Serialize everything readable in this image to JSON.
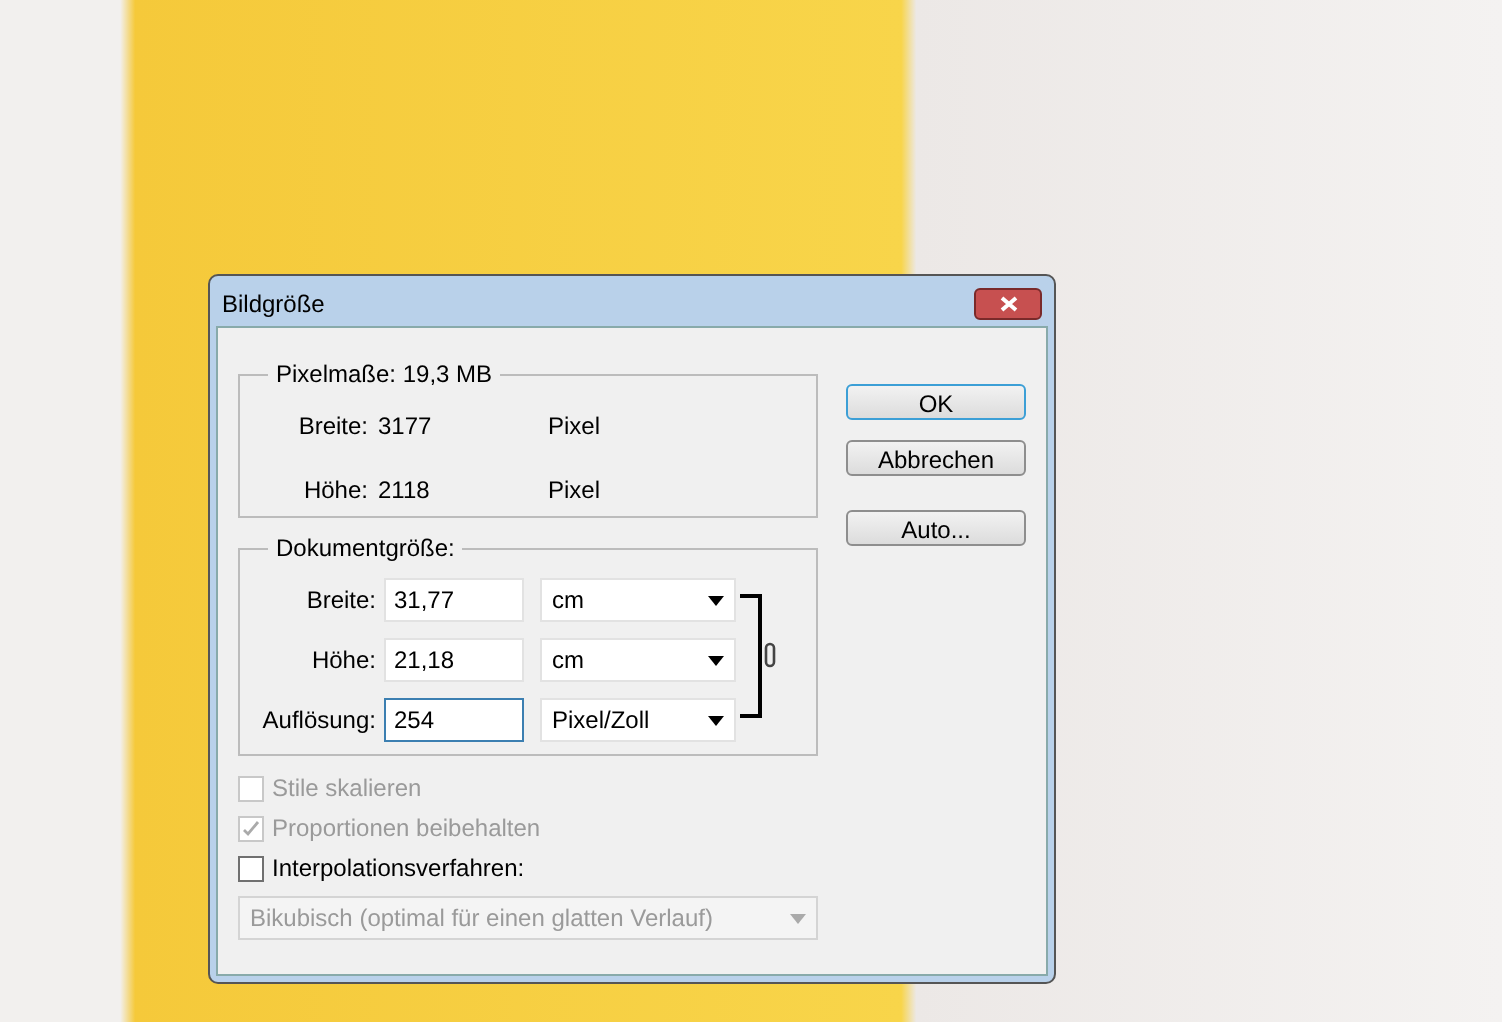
{
  "window": {
    "title": "Bildgröße"
  },
  "pixel_dimensions": {
    "legend": "Pixelmaße: 19,3 MB",
    "rows": [
      {
        "label": "Breite:",
        "value": "3177",
        "unit": "Pixel"
      },
      {
        "label": "Höhe:",
        "value": "2118",
        "unit": "Pixel"
      }
    ]
  },
  "document_size": {
    "legend": "Dokumentgröße:",
    "rows": [
      {
        "label": "Breite:",
        "value": "31,77",
        "unit": "cm",
        "focused": false
      },
      {
        "label": "Höhe:",
        "value": "21,18",
        "unit": "cm",
        "focused": false
      },
      {
        "label": "Auflösung:",
        "value": "254",
        "unit": "Pixel/Zoll",
        "focused": true
      }
    ]
  },
  "checkboxes": [
    {
      "label": "Stile skalieren",
      "checked": false,
      "disabled": true
    },
    {
      "label": "Proportionen beibehalten",
      "checked": true,
      "disabled": true
    },
    {
      "label": "Interpolationsverfahren:",
      "checked": false,
      "disabled": false
    }
  ],
  "resample": {
    "value": "Bikubisch (optimal für einen glatten Verlauf)",
    "disabled": true
  },
  "buttons": [
    {
      "label": "OK",
      "default": true
    },
    {
      "label": "Abbrechen",
      "default": false
    },
    {
      "label": "Auto...",
      "default": false
    }
  ]
}
